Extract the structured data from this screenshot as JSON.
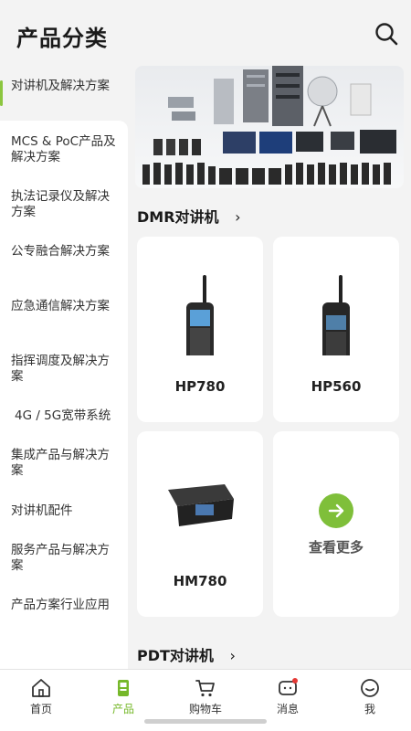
{
  "header": {
    "title": "产品分类",
    "search_icon": "search-icon"
  },
  "sidebar": {
    "items": [
      {
        "label": "对讲机及解决方案",
        "active": true
      },
      {
        "label": "MCS & PoC产品及解决方案"
      },
      {
        "label": "执法记录仪及解决方案"
      },
      {
        "label": "公专融合解决方案"
      },
      {
        "label": "应急通信解决方案"
      },
      {
        "label": "指挥调度及解决方案"
      },
      {
        "label": "4G / 5G宽带系统"
      },
      {
        "label": "集成产品与解决方案"
      },
      {
        "label": "对讲机配件"
      },
      {
        "label": "服务产品与解决方案"
      },
      {
        "label": "产品方案行业应用"
      }
    ],
    "accent": "#8cc63f"
  },
  "main": {
    "section1": {
      "title": "DMR对讲机",
      "chevron": "›"
    },
    "products": [
      {
        "name": "HP780"
      },
      {
        "name": "HP560"
      },
      {
        "name": "HM780"
      }
    ],
    "more": {
      "label": "查看更多",
      "icon": "arrow-right-icon"
    },
    "section2": {
      "title": "PDT对讲机",
      "chevron": "›"
    }
  },
  "tabbar": {
    "items": [
      {
        "label": "首页",
        "icon": "home-icon"
      },
      {
        "label": "产品",
        "icon": "product-icon",
        "active": true
      },
      {
        "label": "购物车",
        "icon": "cart-icon"
      },
      {
        "label": "消息",
        "icon": "message-icon",
        "badge": true
      },
      {
        "label": "我",
        "icon": "profile-icon"
      }
    ],
    "active_color": "#76b82a"
  }
}
